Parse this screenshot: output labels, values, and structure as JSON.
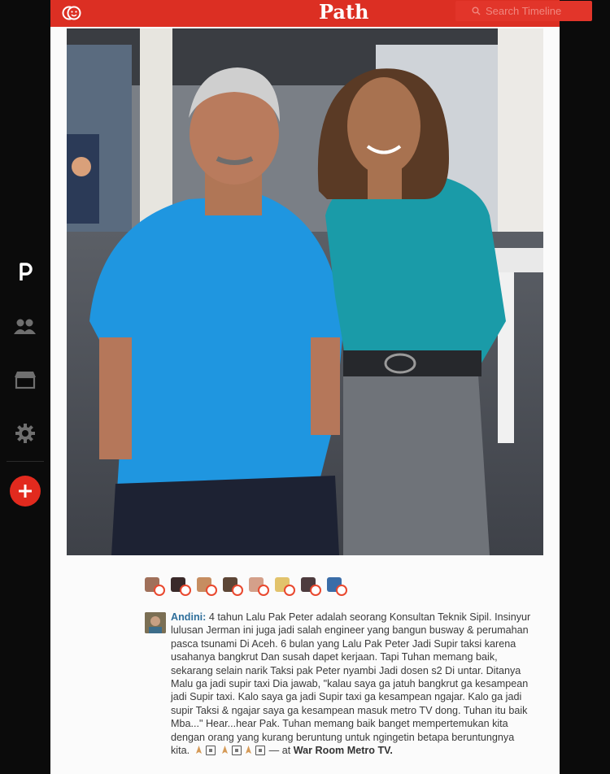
{
  "app": {
    "logo_text": "Path",
    "brand_color": "#dc2f23",
    "search_placeholder": "Search Timeline"
  },
  "nav": {
    "items": [
      {
        "name": "path-icon"
      },
      {
        "name": "friends-icon"
      },
      {
        "name": "shop-icon"
      },
      {
        "name": "settings-icon"
      }
    ],
    "add_button": "add-icon"
  },
  "post": {
    "emotions": [
      {
        "name": "emotion-1"
      },
      {
        "name": "emotion-2"
      },
      {
        "name": "emotion-3"
      },
      {
        "name": "emotion-4"
      },
      {
        "name": "emotion-5"
      },
      {
        "name": "emotion-6"
      },
      {
        "name": "emotion-7"
      },
      {
        "name": "emotion-8"
      }
    ],
    "comment": {
      "author": "Andini:",
      "body": " 4 tahun Lalu Pak Peter adalah seorang Konsultan Teknik Sipil. Insinyur lulusan Jerman ini juga jadi salah engineer yang bangun busway & perumahan pasca tsunami Di Aceh. 6 bulan yang Lalu Pak Peter Jadi Supir taksi karena usahanya bangkrut Dan susah dapet kerjaan. Tapi Tuhan memang baik, sekarang selain narik Taksi pak Peter nyambi Jadi dosen s2 Di untar. Ditanya Malu ga jadi supir taxi Dia jawab, \"kalau saya ga jatuh bangkrut ga kesampean jadi Supir taxi. Kalo saya ga jadi Supir taxi ga kesampean ngajar. Kalo ga jadi supir Taksi & ngajar saya ga kesampean masuk metro TV dong. Tuhan itu baik Mba...\" Hear...hear Pak. Tuhan memang baik banget mempertemukan kita dengan orang yang kurang beruntung untuk ngingetin betapa beruntungnya kita. ",
      "at_text": " — at ",
      "location": "War Room Metro TV."
    }
  }
}
